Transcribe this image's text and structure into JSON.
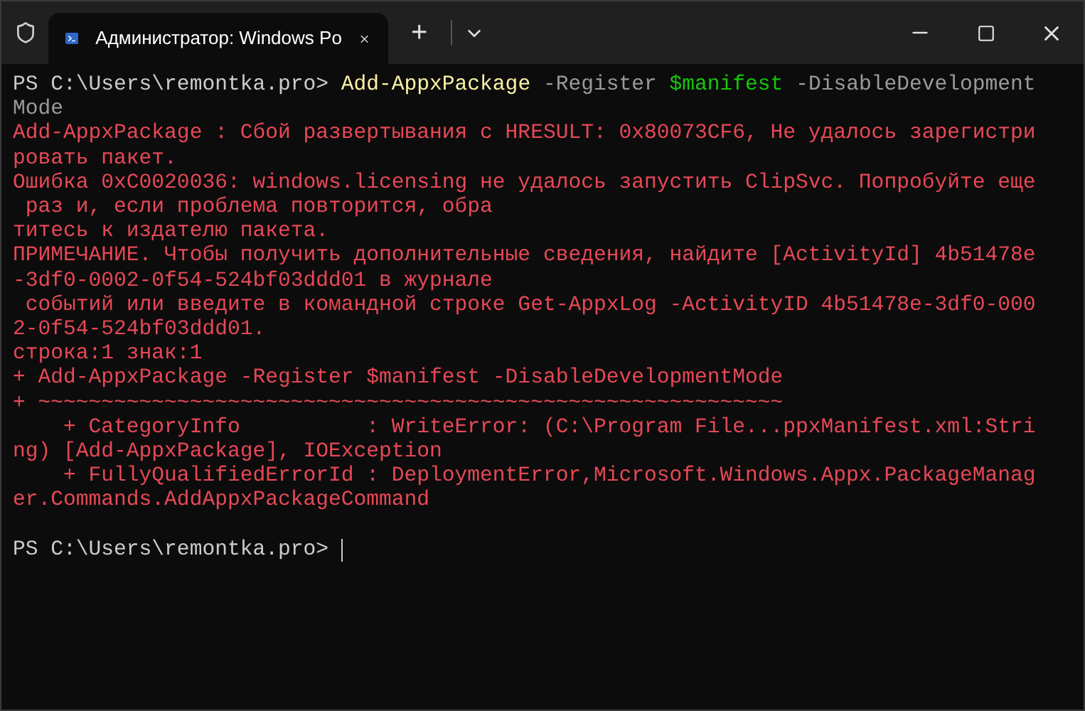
{
  "window": {
    "tab": {
      "title": "Администратор: Windows Po",
      "selected": true
    },
    "new_tab_button": "+"
  },
  "terminal": {
    "cursor_visible": true,
    "lines": [
      {
        "segments": [
          {
            "kind": "prompt",
            "text": "PS C:\\Users\\remontka.pro> "
          },
          {
            "kind": "command",
            "text": "Add-AppxPackage"
          },
          {
            "kind": "param",
            "text": " -Register "
          },
          {
            "kind": "variable",
            "text": "$manifest"
          },
          {
            "kind": "param",
            "text": " -DisableDevelopment"
          }
        ]
      },
      {
        "segments": [
          {
            "kind": "param",
            "text": "Mode"
          }
        ]
      },
      {
        "segments": [
          {
            "kind": "error",
            "text": "Add-AppxPackage : Сбой развертывания с HRESULT: 0x80073CF6, Не удалось зарегистри"
          }
        ]
      },
      {
        "segments": [
          {
            "kind": "error",
            "text": "ровать пакет."
          }
        ]
      },
      {
        "segments": [
          {
            "kind": "error",
            "text": "Ошибка 0xC0020036: windows.licensing не удалось запустить ClipSvc. Попробуйте еще"
          }
        ]
      },
      {
        "segments": [
          {
            "kind": "error",
            "text": " раз и, если проблема повторится, обра"
          }
        ]
      },
      {
        "segments": [
          {
            "kind": "error",
            "text": "титесь к издателю пакета."
          }
        ]
      },
      {
        "segments": [
          {
            "kind": "error",
            "text": "ПРИМЕЧАНИЕ. Чтобы получить дополнительные сведения, найдите [ActivityId] 4b51478e"
          }
        ]
      },
      {
        "segments": [
          {
            "kind": "error",
            "text": "-3df0-0002-0f54-524bf03ddd01 в журнале"
          }
        ]
      },
      {
        "segments": [
          {
            "kind": "error",
            "text": " событий или введите в командной строке Get-AppxLog -ActivityID 4b51478e-3df0-000"
          }
        ]
      },
      {
        "segments": [
          {
            "kind": "error",
            "text": "2-0f54-524bf03ddd01."
          }
        ]
      },
      {
        "segments": [
          {
            "kind": "error",
            "text": "строка:1 знак:1"
          }
        ]
      },
      {
        "segments": [
          {
            "kind": "error",
            "text": "+ Add-AppxPackage -Register $manifest -DisableDevelopmentMode"
          }
        ]
      },
      {
        "segments": [
          {
            "kind": "error",
            "text": "+ ~~~~~~~~~~~~~~~~~~~~~~~~~~~~~~~~~~~~~~~~~~~~~~~~~~~~~~~~~~~"
          }
        ]
      },
      {
        "segments": [
          {
            "kind": "error",
            "text": "    + CategoryInfo          : WriteError: (C:\\Program File...ppxManifest.xml:Stri"
          }
        ]
      },
      {
        "segments": [
          {
            "kind": "error",
            "text": "ng) [Add-AppxPackage], IOException"
          }
        ]
      },
      {
        "segments": [
          {
            "kind": "error",
            "text": "    + FullyQualifiedErrorId : DeploymentError,Microsoft.Windows.Appx.PackageManag"
          }
        ]
      },
      {
        "segments": [
          {
            "kind": "error",
            "text": "er.Commands.AddAppxPackageCommand"
          }
        ]
      }
    ],
    "current_prompt": "PS C:\\Users\\remontka.pro> "
  }
}
